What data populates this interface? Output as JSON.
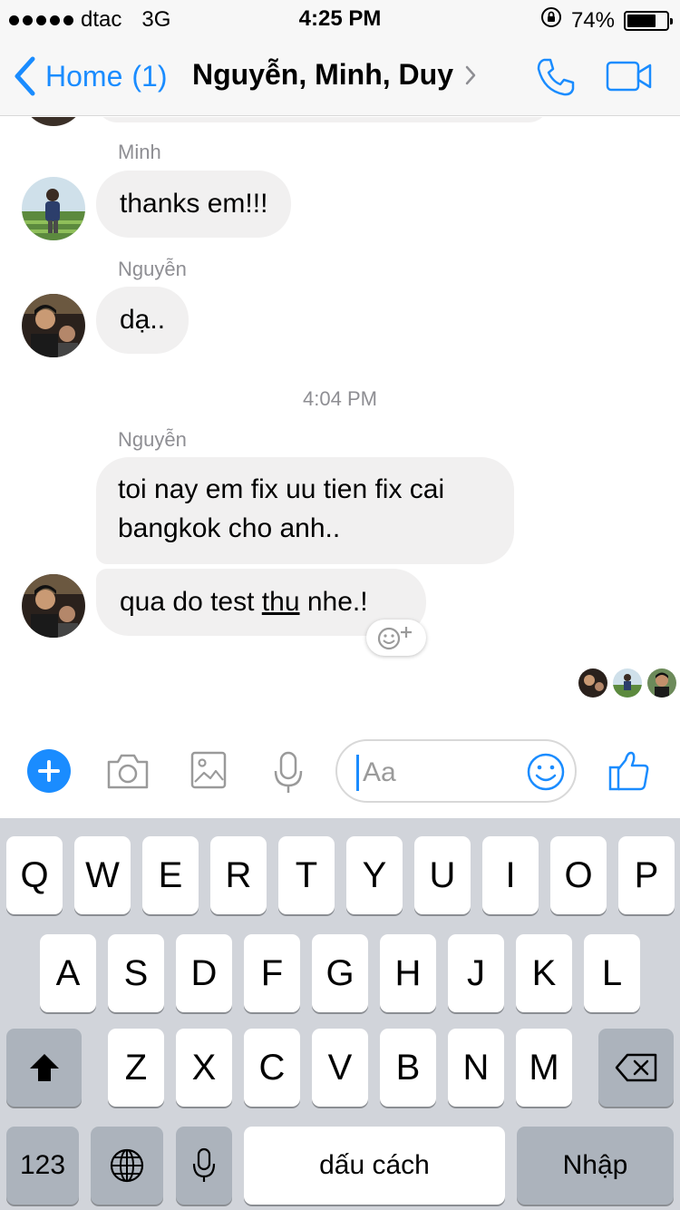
{
  "status_bar": {
    "carrier": "dtac",
    "network": "3G",
    "time": "4:25 PM",
    "battery_percent_label": "74%",
    "battery_level": 0.74
  },
  "nav": {
    "back_label": "Home",
    "back_count": "(1)",
    "title": "Nguyễn, Minh, Duy",
    "accent_color": "#1a8cff"
  },
  "messages": {
    "group1": {
      "sender": "Minh",
      "text": "thanks em!!!"
    },
    "group2": {
      "sender": "Nguyễn",
      "text": "dạ.."
    },
    "timestamp": "4:04 PM",
    "group3": {
      "sender": "Nguyễn",
      "text_line1": "toi nay em fix uu tien fix cai",
      "text_line2": "bangkok cho anh..",
      "last_pre": "qua do test ",
      "last_underlined": "thu",
      "last_post": " nhe.!"
    }
  },
  "composer": {
    "placeholder": "Aa"
  },
  "keyboard": {
    "row1": [
      "Q",
      "W",
      "E",
      "R",
      "T",
      "Y",
      "U",
      "I",
      "O",
      "P"
    ],
    "row2": [
      "A",
      "S",
      "D",
      "F",
      "G",
      "H",
      "J",
      "K",
      "L"
    ],
    "row3": [
      "Z",
      "X",
      "C",
      "V",
      "B",
      "N",
      "M"
    ],
    "numbers_label": "123",
    "space_label": "dấu cách",
    "return_label": "Nhập"
  }
}
